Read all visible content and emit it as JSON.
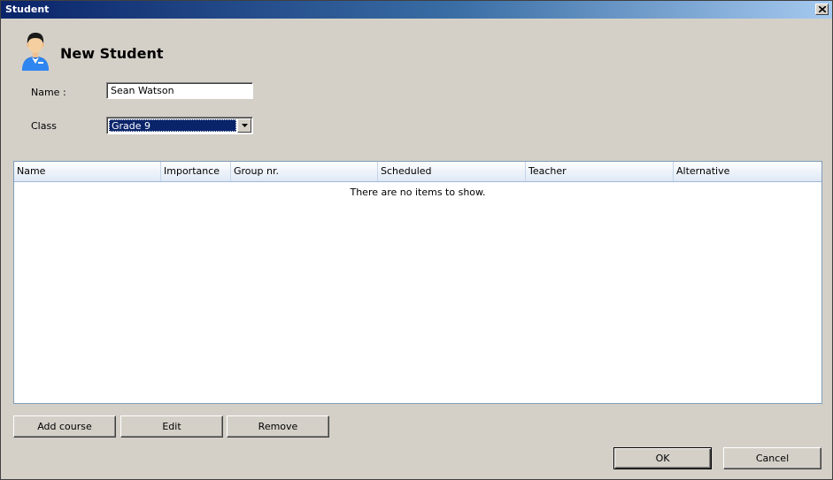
{
  "window": {
    "title": "Student"
  },
  "header": {
    "title": "New Student",
    "icon": "student-avatar-icon"
  },
  "form": {
    "name_label": "Name :",
    "name_value": "Sean Watson",
    "class_label": "Class",
    "class_value": "Grade 9"
  },
  "list": {
    "columns": [
      "Name",
      "Importance",
      "Group nr.",
      "Scheduled",
      "Teacher",
      "Alternative"
    ],
    "empty_text": "There are no items to show."
  },
  "buttons": {
    "add_course": "Add course",
    "edit": "Edit",
    "remove": "Remove",
    "ok": "OK",
    "cancel": "Cancel"
  },
  "colors": {
    "titlebar_start": "#0a246a",
    "titlebar_end": "#a6caf0",
    "dialog_bg": "#d4d0c8",
    "selection": "#0a246a"
  }
}
